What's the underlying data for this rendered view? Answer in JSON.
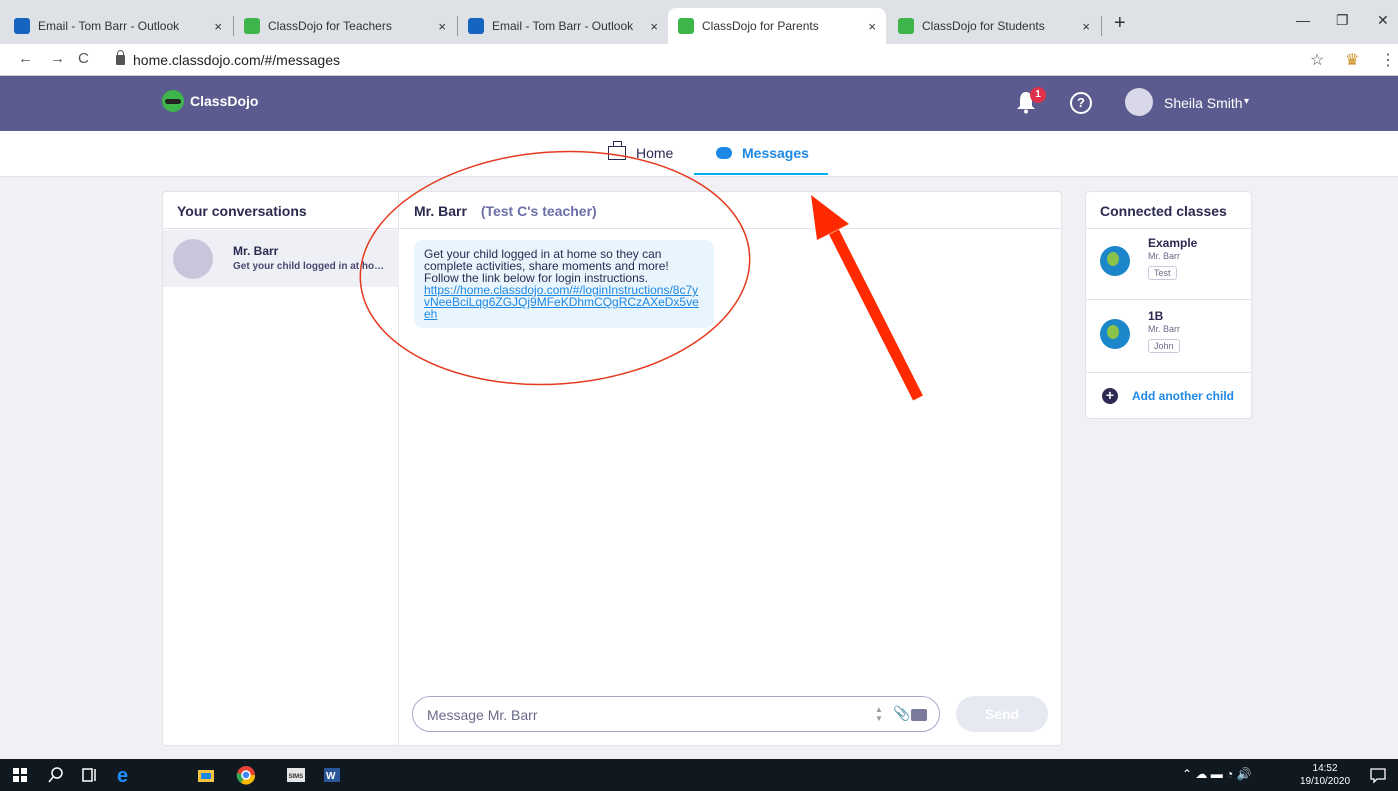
{
  "browser": {
    "tabs": [
      {
        "title": "Email - Tom Barr - Outlook",
        "active": false,
        "favicon_color": "#1565c0"
      },
      {
        "title": "ClassDojo for Teachers",
        "active": false,
        "favicon_color": "#3db54a"
      },
      {
        "title": "Email - Tom Barr - Outlook",
        "active": false,
        "favicon_color": "#1565c0"
      },
      {
        "title": "ClassDojo for Parents",
        "active": true,
        "favicon_color": "#3db54a"
      },
      {
        "title": "ClassDojo for Students",
        "active": false,
        "favicon_color": "#3db54a"
      }
    ],
    "tab_close": "×",
    "new_tab": "+",
    "minimize": "—",
    "maximize": "❐",
    "close": "✕",
    "back": "←",
    "forward": "→",
    "reload": "C",
    "url": "home.classdojo.com/#/messages",
    "star": "☆",
    "crown": "♛",
    "menu": "⋮"
  },
  "header": {
    "brand": "ClassDojo",
    "notification_count": "1",
    "help": "?",
    "user_name": "Sheila Smith",
    "caret": "▾"
  },
  "nav": {
    "home": "Home",
    "messages": "Messages",
    "active": "messages"
  },
  "conversations": {
    "heading": "Your conversations",
    "items": [
      {
        "name": "Mr. Barr",
        "preview": "Get your child logged in at home so they can complete activities, share moments and more!"
      }
    ]
  },
  "thread": {
    "name": "Mr. Barr",
    "subtitle": "(Test C's teacher)",
    "message_text": "Get your child logged in at home so they can complete activities, share moments and more! Follow the link below for login instructions.",
    "message_link": "https://home.classdojo.com/#/loginInstructions/8c7yvNeeBciLqg6ZGJQj9MFeKDhmCQgRCzAXeDx5veeh",
    "composer_placeholder": "Message Mr. Barr",
    "send_label": "Send",
    "spinner": "▲\n▼",
    "clip": "📎"
  },
  "connected": {
    "heading": "Connected classes",
    "classes": [
      {
        "name": "Example",
        "teacher": "Mr. Barr",
        "child": "Test"
      },
      {
        "name": "1B",
        "teacher": "Mr. Barr",
        "child": "John"
      }
    ],
    "add_child": "Add another child",
    "add_symbol": "+"
  },
  "annotations": {
    "ellipse_color": "#e53a1f",
    "arrow_color": "#ff2a00"
  },
  "taskbar": {
    "time": "14:52",
    "date": "19/10/2020",
    "tray_icons": "⌃ ☁ ▬ ◔ 🔊"
  }
}
